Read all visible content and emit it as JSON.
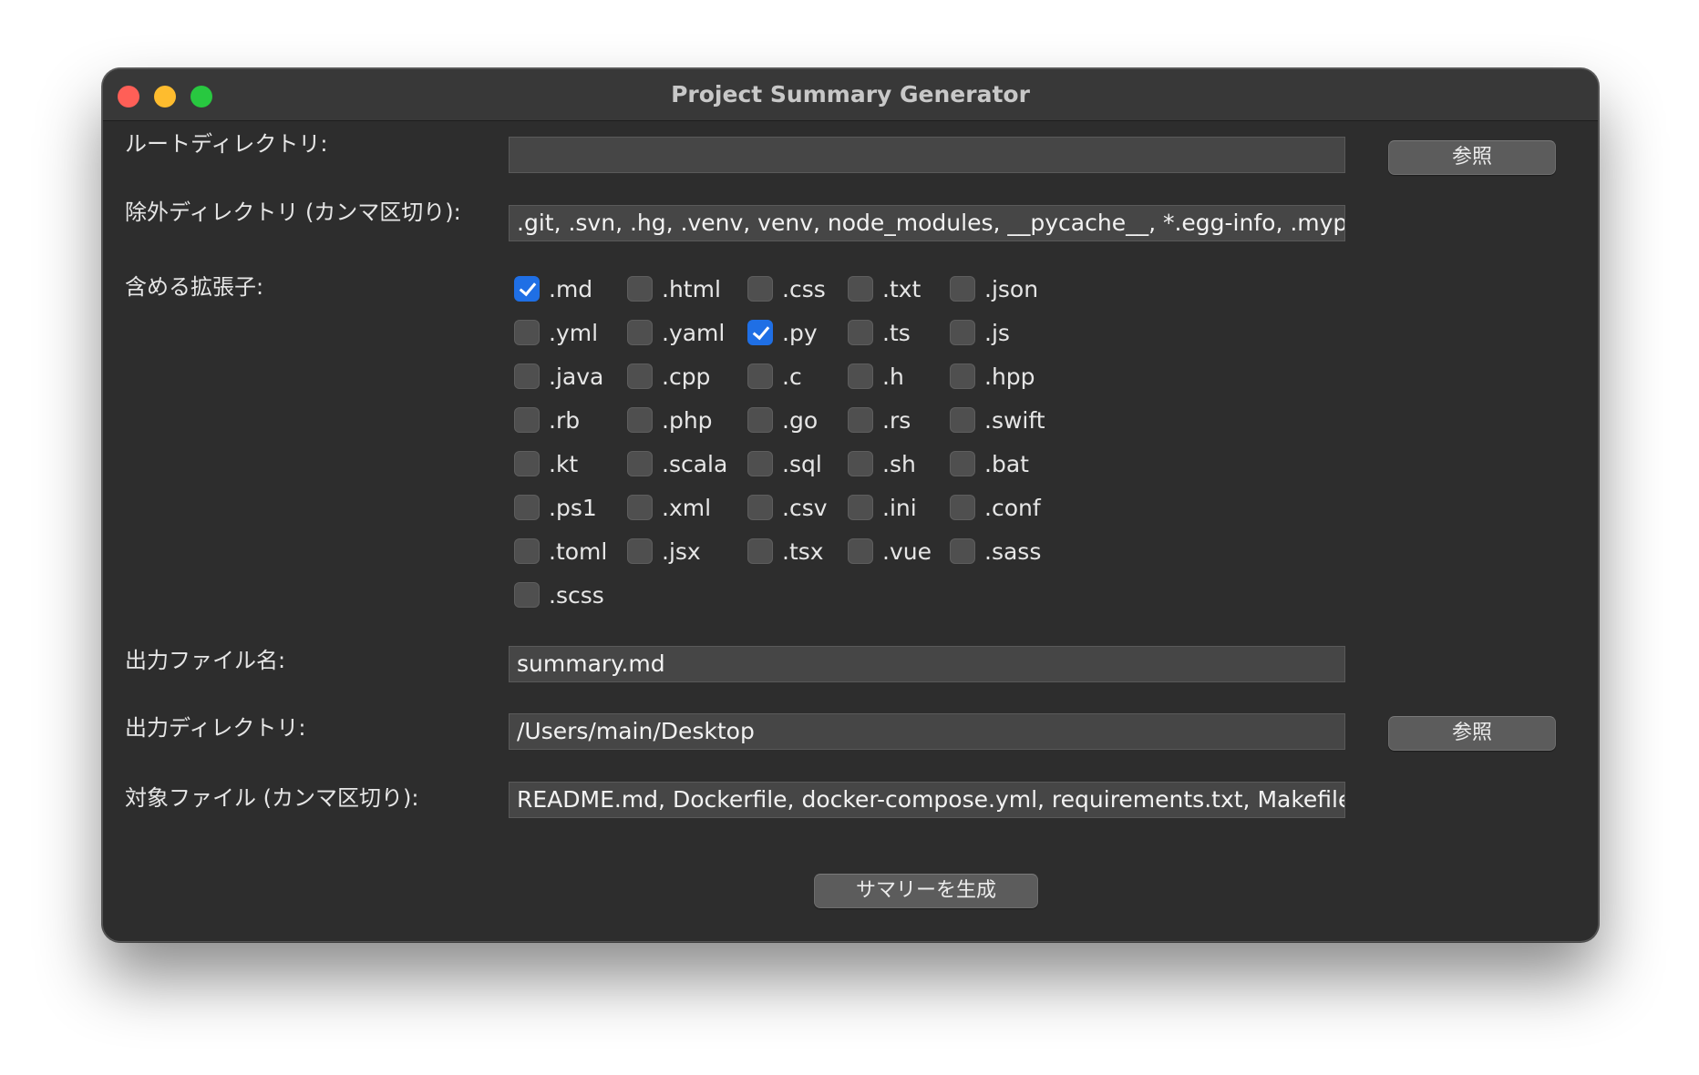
{
  "window": {
    "title": "Project Summary Generator"
  },
  "root_dir": {
    "label": "ルートディレクトリ:",
    "value": "",
    "browse_label": "参照"
  },
  "exclude_dirs": {
    "label": "除外ディレクトリ (カンマ区切り):",
    "value": ".git, .svn, .hg, .venv, venv, node_modules, __pycache__, *.egg-info, .mypy"
  },
  "extensions": {
    "label": "含める拡張子:",
    "items": [
      {
        "name": ".md",
        "checked": true
      },
      {
        "name": ".html",
        "checked": false
      },
      {
        "name": ".css",
        "checked": false
      },
      {
        "name": ".txt",
        "checked": false
      },
      {
        "name": ".json",
        "checked": false
      },
      {
        "name": ".yml",
        "checked": false
      },
      {
        "name": ".yaml",
        "checked": false
      },
      {
        "name": ".py",
        "checked": true
      },
      {
        "name": ".ts",
        "checked": false
      },
      {
        "name": ".js",
        "checked": false
      },
      {
        "name": ".java",
        "checked": false
      },
      {
        "name": ".cpp",
        "checked": false
      },
      {
        "name": ".c",
        "checked": false
      },
      {
        "name": ".h",
        "checked": false
      },
      {
        "name": ".hpp",
        "checked": false
      },
      {
        "name": ".rb",
        "checked": false
      },
      {
        "name": ".php",
        "checked": false
      },
      {
        "name": ".go",
        "checked": false
      },
      {
        "name": ".rs",
        "checked": false
      },
      {
        "name": ".swift",
        "checked": false
      },
      {
        "name": ".kt",
        "checked": false
      },
      {
        "name": ".scala",
        "checked": false
      },
      {
        "name": ".sql",
        "checked": false
      },
      {
        "name": ".sh",
        "checked": false
      },
      {
        "name": ".bat",
        "checked": false
      },
      {
        "name": ".ps1",
        "checked": false
      },
      {
        "name": ".xml",
        "checked": false
      },
      {
        "name": ".csv",
        "checked": false
      },
      {
        "name": ".ini",
        "checked": false
      },
      {
        "name": ".conf",
        "checked": false
      },
      {
        "name": ".toml",
        "checked": false
      },
      {
        "name": ".jsx",
        "checked": false
      },
      {
        "name": ".tsx",
        "checked": false
      },
      {
        "name": ".vue",
        "checked": false
      },
      {
        "name": ".sass",
        "checked": false
      },
      {
        "name": ".scss",
        "checked": false
      }
    ]
  },
  "output_file": {
    "label": "出力ファイル名:",
    "value": "summary.md"
  },
  "output_dir": {
    "label": "出力ディレクトリ:",
    "value": "/Users/main/Desktop",
    "browse_label": "参照"
  },
  "target_files": {
    "label": "対象ファイル (カンマ区切り):",
    "value": "README.md, Dockerfile, docker-compose.yml, requirements.txt, Makefile,"
  },
  "generate_button": {
    "label": "サマリーを生成"
  }
}
